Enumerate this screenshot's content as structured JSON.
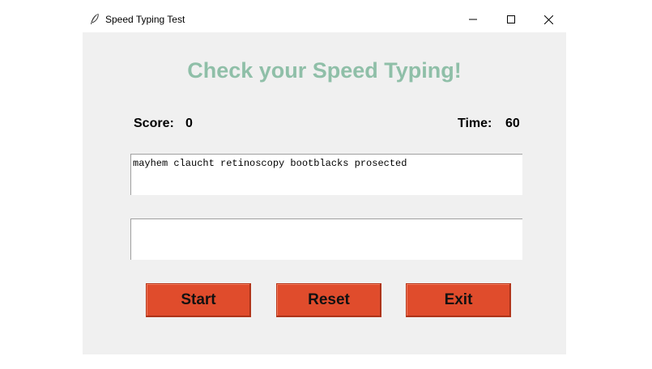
{
  "window": {
    "title": "Speed Typing Test",
    "icon": "feather-icon",
    "controls": [
      "minimize-icon",
      "maximize-icon",
      "close-icon"
    ]
  },
  "main": {
    "heading": "Check your Speed Typing!",
    "score_label": "Score:",
    "score_value": "0",
    "time_label": "Time:",
    "time_value": "60",
    "words": "mayhem claucht retinoscopy bootblacks prosected",
    "input_value": ""
  },
  "buttons": {
    "start": "Start",
    "reset": "Reset",
    "exit": "Exit"
  },
  "colors": {
    "heading": "#8fbfa8",
    "button_bg": "#e04c2c",
    "background": "#f0f0f0"
  }
}
